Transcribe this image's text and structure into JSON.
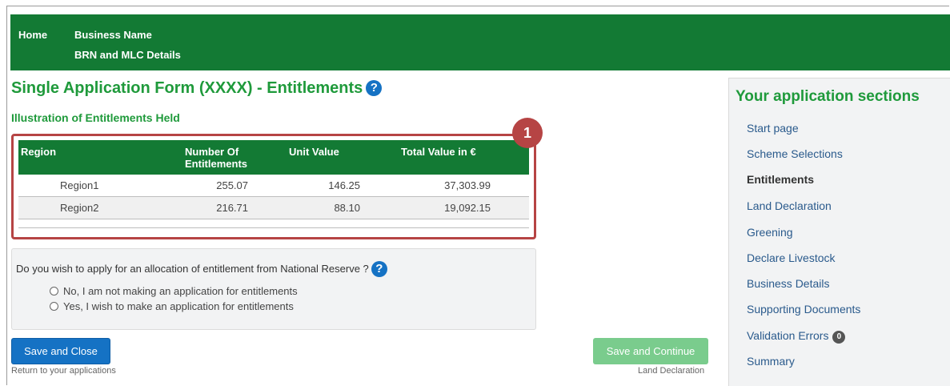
{
  "nav": {
    "home": "Home",
    "business_name": "Business Name",
    "brn_mlc": "BRN and MLC Details"
  },
  "page": {
    "title": "Single Application Form (XXXX) - Entitlements",
    "help_icon": "?",
    "subtitle": "Illustration of Entitlements Held"
  },
  "callout": {
    "number": "1",
    "color": "#b64444"
  },
  "table": {
    "headers": [
      "Region",
      "Number Of Entitlements",
      "Unit Value",
      "Total Value in €"
    ],
    "rows": [
      [
        "Region1",
        "255.07",
        "146.25",
        "37,303.99"
      ],
      [
        "Region2",
        "216.71",
        "88.10",
        "19,092.15"
      ]
    ]
  },
  "national_reserve": {
    "question": "Do you wish to apply for an allocation of entitlement from National Reserve ?",
    "help_icon": "?",
    "options": [
      "No, I am not making an application for entitlements",
      "Yes, I wish to make an application for entitlements"
    ]
  },
  "actions": {
    "save_close": "Save and Close",
    "return_link": "Return to your applications",
    "save_continue": "Save and Continue",
    "next_section": "Land Declaration"
  },
  "sidebar": {
    "title": "Your application sections",
    "items": [
      {
        "label": "Start page"
      },
      {
        "label": "Scheme Selections"
      },
      {
        "label": "Entitlements"
      },
      {
        "label": "Land Declaration"
      },
      {
        "label": "Greening"
      },
      {
        "label": "Declare Livestock"
      },
      {
        "label": "Business Details"
      },
      {
        "label": "Supporting Documents"
      },
      {
        "label": "Validation Errors",
        "badge": "0"
      },
      {
        "label": "Summary"
      }
    ]
  },
  "colors": {
    "brand_green": "#137a34",
    "title_green": "#1f9a3b",
    "primary_blue": "#1572c4",
    "disabled_green": "#7acc8d"
  },
  "icons": {
    "help": "question-circle-icon",
    "radio": "radio-unchecked-icon"
  }
}
